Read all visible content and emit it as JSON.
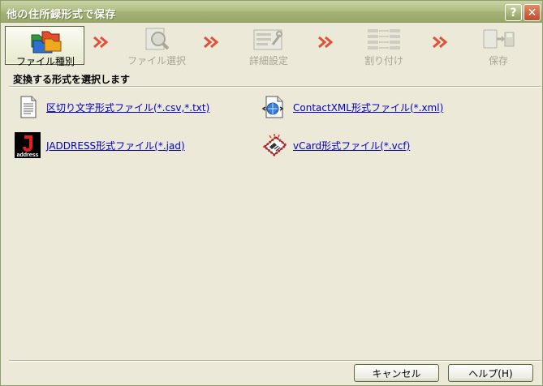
{
  "window": {
    "title": "他の住所録形式で保存",
    "help_glyph": "?",
    "close_glyph": "✕"
  },
  "steps": [
    {
      "label": "ファイル種別",
      "icon": "folders-icon",
      "active": true
    },
    {
      "label": "ファイル選択",
      "icon": "file-search-icon",
      "active": false
    },
    {
      "label": "詳細設定",
      "icon": "settings-tools-icon",
      "active": false
    },
    {
      "label": "割り付け",
      "icon": "field-mapping-icon",
      "active": false
    },
    {
      "label": "保存",
      "icon": "save-disk-icon",
      "active": false
    }
  ],
  "instruction": "変換する形式を選択します",
  "formats": [
    {
      "label": "区切り文字形式ファイル(*.csv,*.txt)",
      "icon": "text-document-icon"
    },
    {
      "label": "ContactXML形式ファイル(*.xml)",
      "icon": "xml-document-icon"
    },
    {
      "label": "JADDRESS形式ファイル(*.jad)",
      "icon": "jaddress-logo-icon",
      "logo_text": "address"
    },
    {
      "label": "vCard形式ファイル(*.vcf)",
      "icon": "vcard-icon"
    }
  ],
  "buttons": {
    "cancel": "キャンセル",
    "help": "ヘルプ(H)"
  },
  "colors": {
    "title_gradient_top": "#c8d3a4",
    "title_gradient_bottom": "#98a86a",
    "link": "#0000cc",
    "arrow": "#e0503a",
    "disabled_text": "#a7a595"
  }
}
